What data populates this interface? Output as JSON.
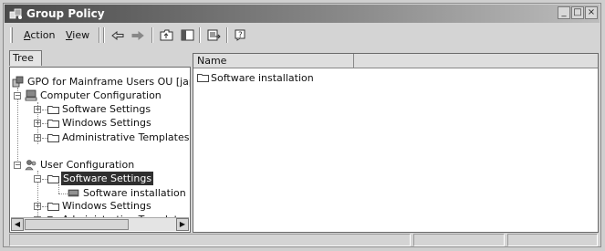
{
  "window": {
    "title": "Group Policy",
    "controls": {
      "minimize": "_",
      "maximize": "□",
      "close": "×"
    }
  },
  "menu": {
    "action": {
      "mnemonic": "A",
      "rest": "ction"
    },
    "view": {
      "mnemonic": "V",
      "rest": "iew"
    }
  },
  "toolbar": {
    "icons": [
      "back-arrow-icon",
      "forward-arrow-icon",
      "up-one-level-icon",
      "show-hide-tree-icon",
      "export-list-icon",
      "help-icon"
    ]
  },
  "tree": {
    "tab_label": "Tree",
    "root": "GPO for Mainframe Users OU [japar",
    "computer_configuration": "Computer Configuration",
    "cc_software_settings": "Software Settings",
    "cc_windows_settings": "Windows Settings",
    "cc_admin_templates": "Administrative Templates",
    "user_configuration": "User Configuration",
    "uc_software_settings": "Software Settings",
    "uc_software_installation": "Software installation",
    "uc_windows_settings": "Windows Settings",
    "uc_admin_templates": "Administrative Templates",
    "selected_item": "Software Settings"
  },
  "list": {
    "columns": [
      "Name",
      ""
    ],
    "items": [
      "Software installation"
    ]
  },
  "colors": {
    "selection": "#2f2f2f",
    "titlebar": "#4a4a4a"
  }
}
